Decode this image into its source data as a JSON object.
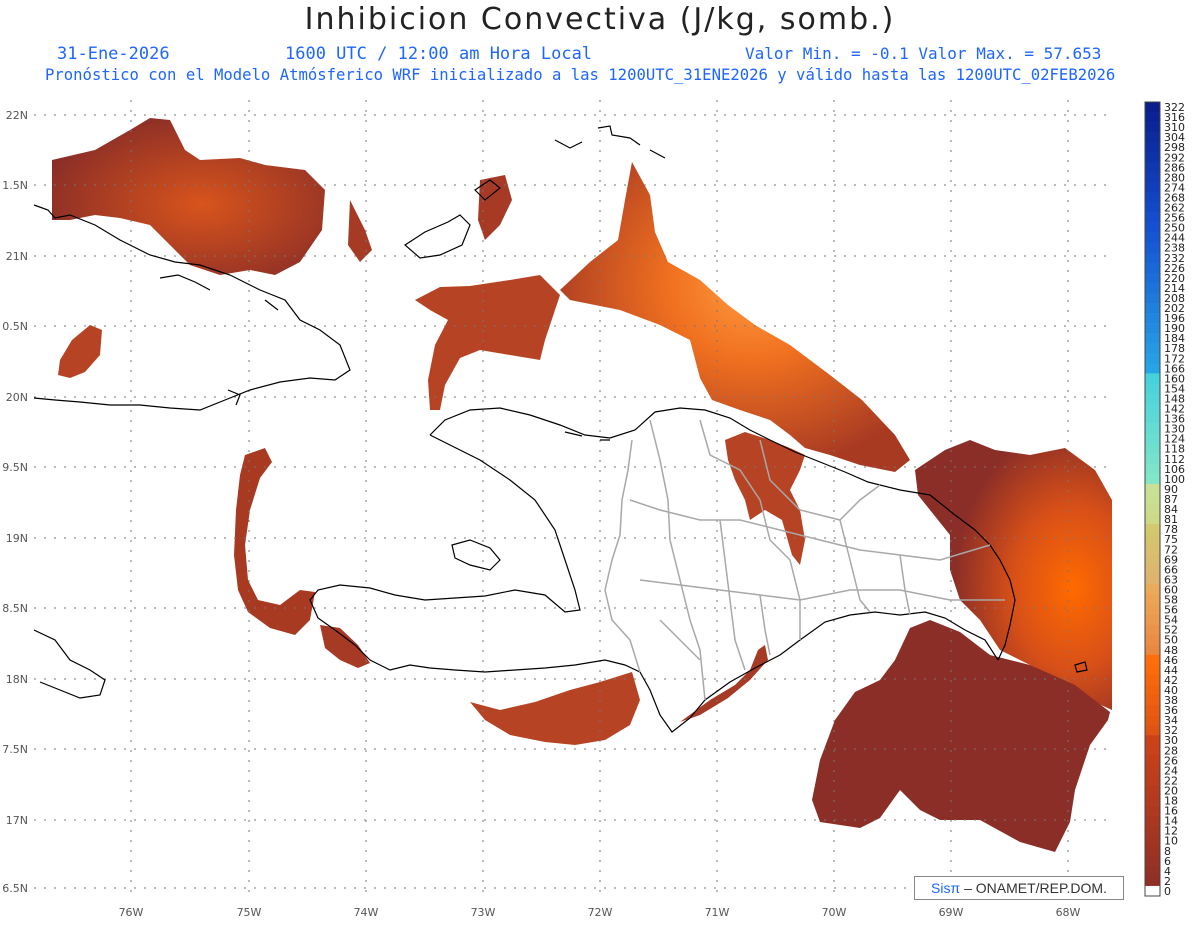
{
  "header": {
    "title": "Inhibicion Convectiva (J/kg, somb.)",
    "date": "31-Ene-2026",
    "time": "1600 UTC / 12:00 am Hora Local",
    "range": "Valor Min. = -0.1  Valor Max. = 57.653",
    "model_info": "Pronóstico con el Modelo Atmósferico WRF inicializado a las 1200UTC_31ENE2026 y válido hasta las  1200UTC_02FEB2026"
  },
  "axes": {
    "lat_labels": [
      "22N",
      "1.5N",
      "21N",
      "0.5N",
      "20N",
      "9.5N",
      "19N",
      "8.5N",
      "18N",
      "7.5N",
      "17N",
      "6.5N"
    ],
    "lon_labels": [
      "76W",
      "75W",
      "74W",
      "73W",
      "72W",
      "71W",
      "70W",
      "69W",
      "68W"
    ]
  },
  "colorbar": {
    "labels": [
      "322",
      "316",
      "310",
      "304",
      "298",
      "292",
      "286",
      "280",
      "274",
      "268",
      "262",
      "256",
      "250",
      "244",
      "238",
      "232",
      "226",
      "220",
      "214",
      "208",
      "202",
      "196",
      "190",
      "184",
      "178",
      "172",
      "166",
      "160",
      "154",
      "148",
      "142",
      "136",
      "130",
      "124",
      "118",
      "112",
      "106",
      "100",
      "90",
      "87",
      "84",
      "81",
      "78",
      "75",
      "72",
      "69",
      "66",
      "63",
      "60",
      "58",
      "56",
      "54",
      "52",
      "50",
      "48",
      "46",
      "44",
      "42",
      "40",
      "38",
      "36",
      "34",
      "32",
      "30",
      "28",
      "26",
      "24",
      "22",
      "20",
      "18",
      "16",
      "14",
      "12",
      "10",
      "8",
      "6",
      "4",
      "2",
      "0"
    ]
  },
  "credit": {
    "sis": "Sis",
    "pi": "π",
    "tail": "– ONAMET/REP.DOM."
  },
  "colors": {
    "field_dark": "#8b2e27",
    "field_mid": "#c4461d",
    "field_bright": "#ff6a00",
    "coast": "#000000",
    "province": "#a8a8a8"
  }
}
